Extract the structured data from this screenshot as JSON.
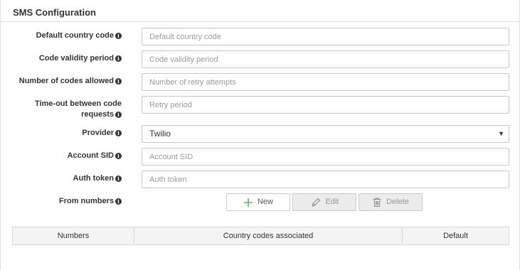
{
  "panel": {
    "title": "SMS Configuration"
  },
  "fields": {
    "default_country_code": {
      "label": "Default country code",
      "placeholder": "Default country code",
      "value": ""
    },
    "code_validity_period": {
      "label": "Code validity period",
      "placeholder": "Code validity period",
      "value": ""
    },
    "number_of_codes": {
      "label": "Number of codes allowed",
      "placeholder": "Number of retry attempts",
      "value": ""
    },
    "timeout": {
      "label_line1": "Time-out between code",
      "label_line2": "requests",
      "placeholder": "Retry period",
      "value": ""
    },
    "provider": {
      "label": "Provider",
      "selected": "Twilio"
    },
    "account_sid": {
      "label": "Account SID",
      "placeholder": "Account SID",
      "value": ""
    },
    "auth_token": {
      "label": "Auth token",
      "placeholder": "Auth token",
      "value": ""
    },
    "from_numbers": {
      "label": "From numbers"
    }
  },
  "info_glyph": "i",
  "select_caret": "▼",
  "toolbar": {
    "new_label": "New",
    "edit_label": "Edit",
    "delete_label": "Delete"
  },
  "table": {
    "columns": [
      "Numbers",
      "Country codes associated",
      "Default"
    ],
    "rows": []
  },
  "colors": {
    "new_plus": "#5cb85c",
    "disabled_text": "#999999",
    "border": "#c6c6c6"
  }
}
